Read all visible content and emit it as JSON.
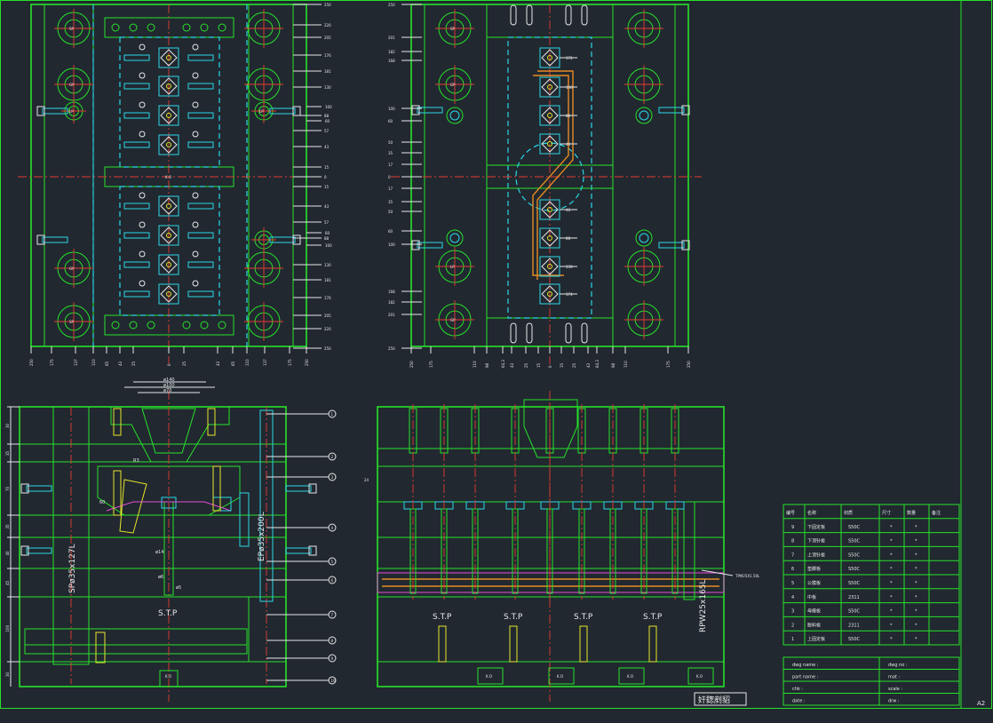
{
  "sheet": {
    "size_code": "A2",
    "stamp": "奸鍯剷貂"
  },
  "plate_a": {
    "dims_right": [
      "250",
      "220",
      "205",
      "176",
      "181",
      "130",
      "88",
      "57",
      "43",
      "15",
      "0",
      "15",
      "43",
      "57",
      "88",
      "130",
      "181",
      "176",
      "205",
      "220",
      "250"
    ],
    "side_right": [
      "100",
      "60",
      "60",
      "100"
    ],
    "dims_bottom": [
      "250",
      "175",
      "137",
      "110",
      "65",
      "43",
      "25",
      "0",
      "25",
      "43",
      "65",
      "110",
      "137",
      "175",
      "250"
    ],
    "comp": [
      "SP",
      "GP",
      "LP",
      "LP",
      "GP",
      "SP",
      "K.O"
    ]
  },
  "plate_b": {
    "dims_left": [
      "250",
      "201",
      "182",
      "168",
      "100",
      "60",
      "50",
      "35",
      "17",
      "0",
      "17",
      "35",
      "50",
      "60",
      "100",
      "168",
      "182",
      "201",
      "250"
    ],
    "dims_right": [
      "172",
      "130",
      "88",
      "44",
      "46",
      "88",
      "130",
      "174"
    ],
    "dims_bottom": [
      "250",
      "175",
      "110",
      "98",
      "64.3",
      "43",
      "25",
      "15",
      "0",
      "15",
      "25",
      "43",
      "64.3",
      "98",
      "110",
      "175",
      "250"
    ],
    "comp": [
      "SP",
      "GP",
      "LP",
      "GP",
      "SP"
    ]
  },
  "sect_a": {
    "top_dims": [
      "ø140",
      "ø100",
      "ø70"
    ],
    "left_dims": [
      "30",
      "35",
      "70",
      "35",
      "40",
      "45",
      "100",
      "30"
    ],
    "vertical_labels": [
      "SPø35x127L",
      "EPø35x200L"
    ],
    "stp": "S.T.P",
    "small_dims": [
      "ø14",
      "ø6",
      "ø5",
      "R3",
      "60"
    ],
    "balloons": [
      "1",
      "2",
      "3",
      "4",
      "5",
      "6",
      "7",
      "8",
      "9",
      "10"
    ],
    "ko": "K.O"
  },
  "sect_b": {
    "vertical_labels": [
      "RPW25x165L"
    ],
    "note": "TPM25X1.50L",
    "stp": [
      "S.T.P",
      "S.T.P",
      "S.T.P",
      "S.T.P"
    ],
    "ko": [
      "K.O",
      "K.O",
      "K.O",
      "K.O"
    ],
    "small_dim": "24"
  },
  "bom": {
    "headers": [
      "编号",
      "名称",
      "材质",
      "尺寸",
      "数量",
      "备注"
    ],
    "rows": [
      {
        "no": "9",
        "name": "下固定板",
        "mat": "S50C",
        "size": "*",
        "qty": "*"
      },
      {
        "no": "8",
        "name": "下顶针板",
        "mat": "S50C",
        "size": "*",
        "qty": "*"
      },
      {
        "no": "7",
        "name": "上顶针板",
        "mat": "S50C",
        "size": "*",
        "qty": "*"
      },
      {
        "no": "6",
        "name": "垫脚板",
        "mat": "S50C",
        "size": "*",
        "qty": "*"
      },
      {
        "no": "5",
        "name": "公模板",
        "mat": "S50C",
        "size": "*",
        "qty": "*"
      },
      {
        "no": "4",
        "name": "中板",
        "mat": "2311",
        "size": "*",
        "qty": "*"
      },
      {
        "no": "3",
        "name": "母模板",
        "mat": "S50C",
        "size": "*",
        "qty": "*"
      },
      {
        "no": "2",
        "name": "脱料板",
        "mat": "2311",
        "size": "*",
        "qty": "*"
      },
      {
        "no": "1",
        "name": "上固定板",
        "mat": "S50C",
        "size": "*",
        "qty": "*"
      }
    ],
    "meta": [
      {
        "left": "dwg name :",
        "right": "dwg no :"
      },
      {
        "left": "part name :",
        "right": "mat :"
      },
      {
        "left": "chk :",
        "right": "scale :"
      },
      {
        "left": "date :",
        "right": "drw :"
      }
    ]
  },
  "colors": {
    "background": "#212830",
    "outline": "#27e22a",
    "center": "#e83a30",
    "cyan": "#2ad7e6",
    "yellow": "#e6e62a",
    "orange": "#e98a22",
    "magenta": "#e34bd5"
  }
}
